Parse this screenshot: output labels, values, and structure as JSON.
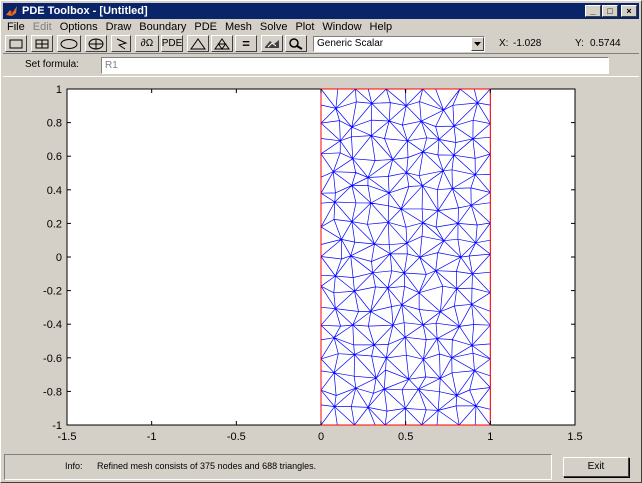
{
  "window": {
    "title": "PDE Toolbox - [Untitled]",
    "controls": {
      "minimize": "_",
      "maximize": "□",
      "close": "×"
    }
  },
  "menu": [
    {
      "label": "File",
      "enabled": true
    },
    {
      "label": "Edit",
      "enabled": false
    },
    {
      "label": "Options",
      "enabled": true
    },
    {
      "label": "Draw",
      "enabled": true
    },
    {
      "label": "Boundary",
      "enabled": true
    },
    {
      "label": "PDE",
      "enabled": true
    },
    {
      "label": "Mesh",
      "enabled": true
    },
    {
      "label": "Solve",
      "enabled": true
    },
    {
      "label": "Plot",
      "enabled": true
    },
    {
      "label": "Window",
      "enabled": true
    },
    {
      "label": "Help",
      "enabled": true
    }
  ],
  "toolbar": {
    "buttons": [
      {
        "name": "rectangle-icon"
      },
      {
        "name": "rectangle-centered-icon"
      },
      {
        "name": "ellipse-icon"
      },
      {
        "name": "ellipse-centered-icon"
      },
      {
        "name": "polygon-icon"
      },
      {
        "name": "boundary-mode-icon",
        "text": "∂Ω"
      },
      {
        "name": "pde-spec-button",
        "text": "PDE"
      },
      {
        "name": "init-mesh-icon"
      },
      {
        "name": "refine-mesh-icon"
      },
      {
        "name": "solve-icon",
        "text": "="
      },
      {
        "name": "plot-icon"
      },
      {
        "name": "zoom-icon"
      }
    ],
    "application": "Generic Scalar",
    "x_label": "X:",
    "x_value": "-1.028",
    "y_label": "Y:",
    "y_value": "0.5744"
  },
  "formula": {
    "label": "Set formula:",
    "value": "R1"
  },
  "colors": {
    "mesh": "#0000ff",
    "boundary": "#ff0000",
    "title_bar": "#0a246a",
    "face": "#d4d0c8"
  },
  "axes": {
    "xticks": [
      "-1.5",
      "-1",
      "-0.5",
      "0",
      "0.5",
      "1",
      "1.5"
    ],
    "yticks": [
      "1",
      "0.8",
      "0.6",
      "0.4",
      "0.2",
      "0",
      "-0.2",
      "-0.4",
      "-0.6",
      "-0.8",
      "-1"
    ],
    "xlim": [
      -1.5,
      1.5
    ],
    "ylim": [
      -1,
      1
    ],
    "rectangle": {
      "label": "R1",
      "x": [
        0,
        1
      ],
      "y": [
        -1,
        1
      ]
    }
  },
  "mesh": {
    "nodes": 375,
    "triangles": 688
  },
  "status": {
    "label": "Info:",
    "message": "Refined mesh consists of 375 nodes and 688 triangles."
  },
  "exit_label": "Exit"
}
